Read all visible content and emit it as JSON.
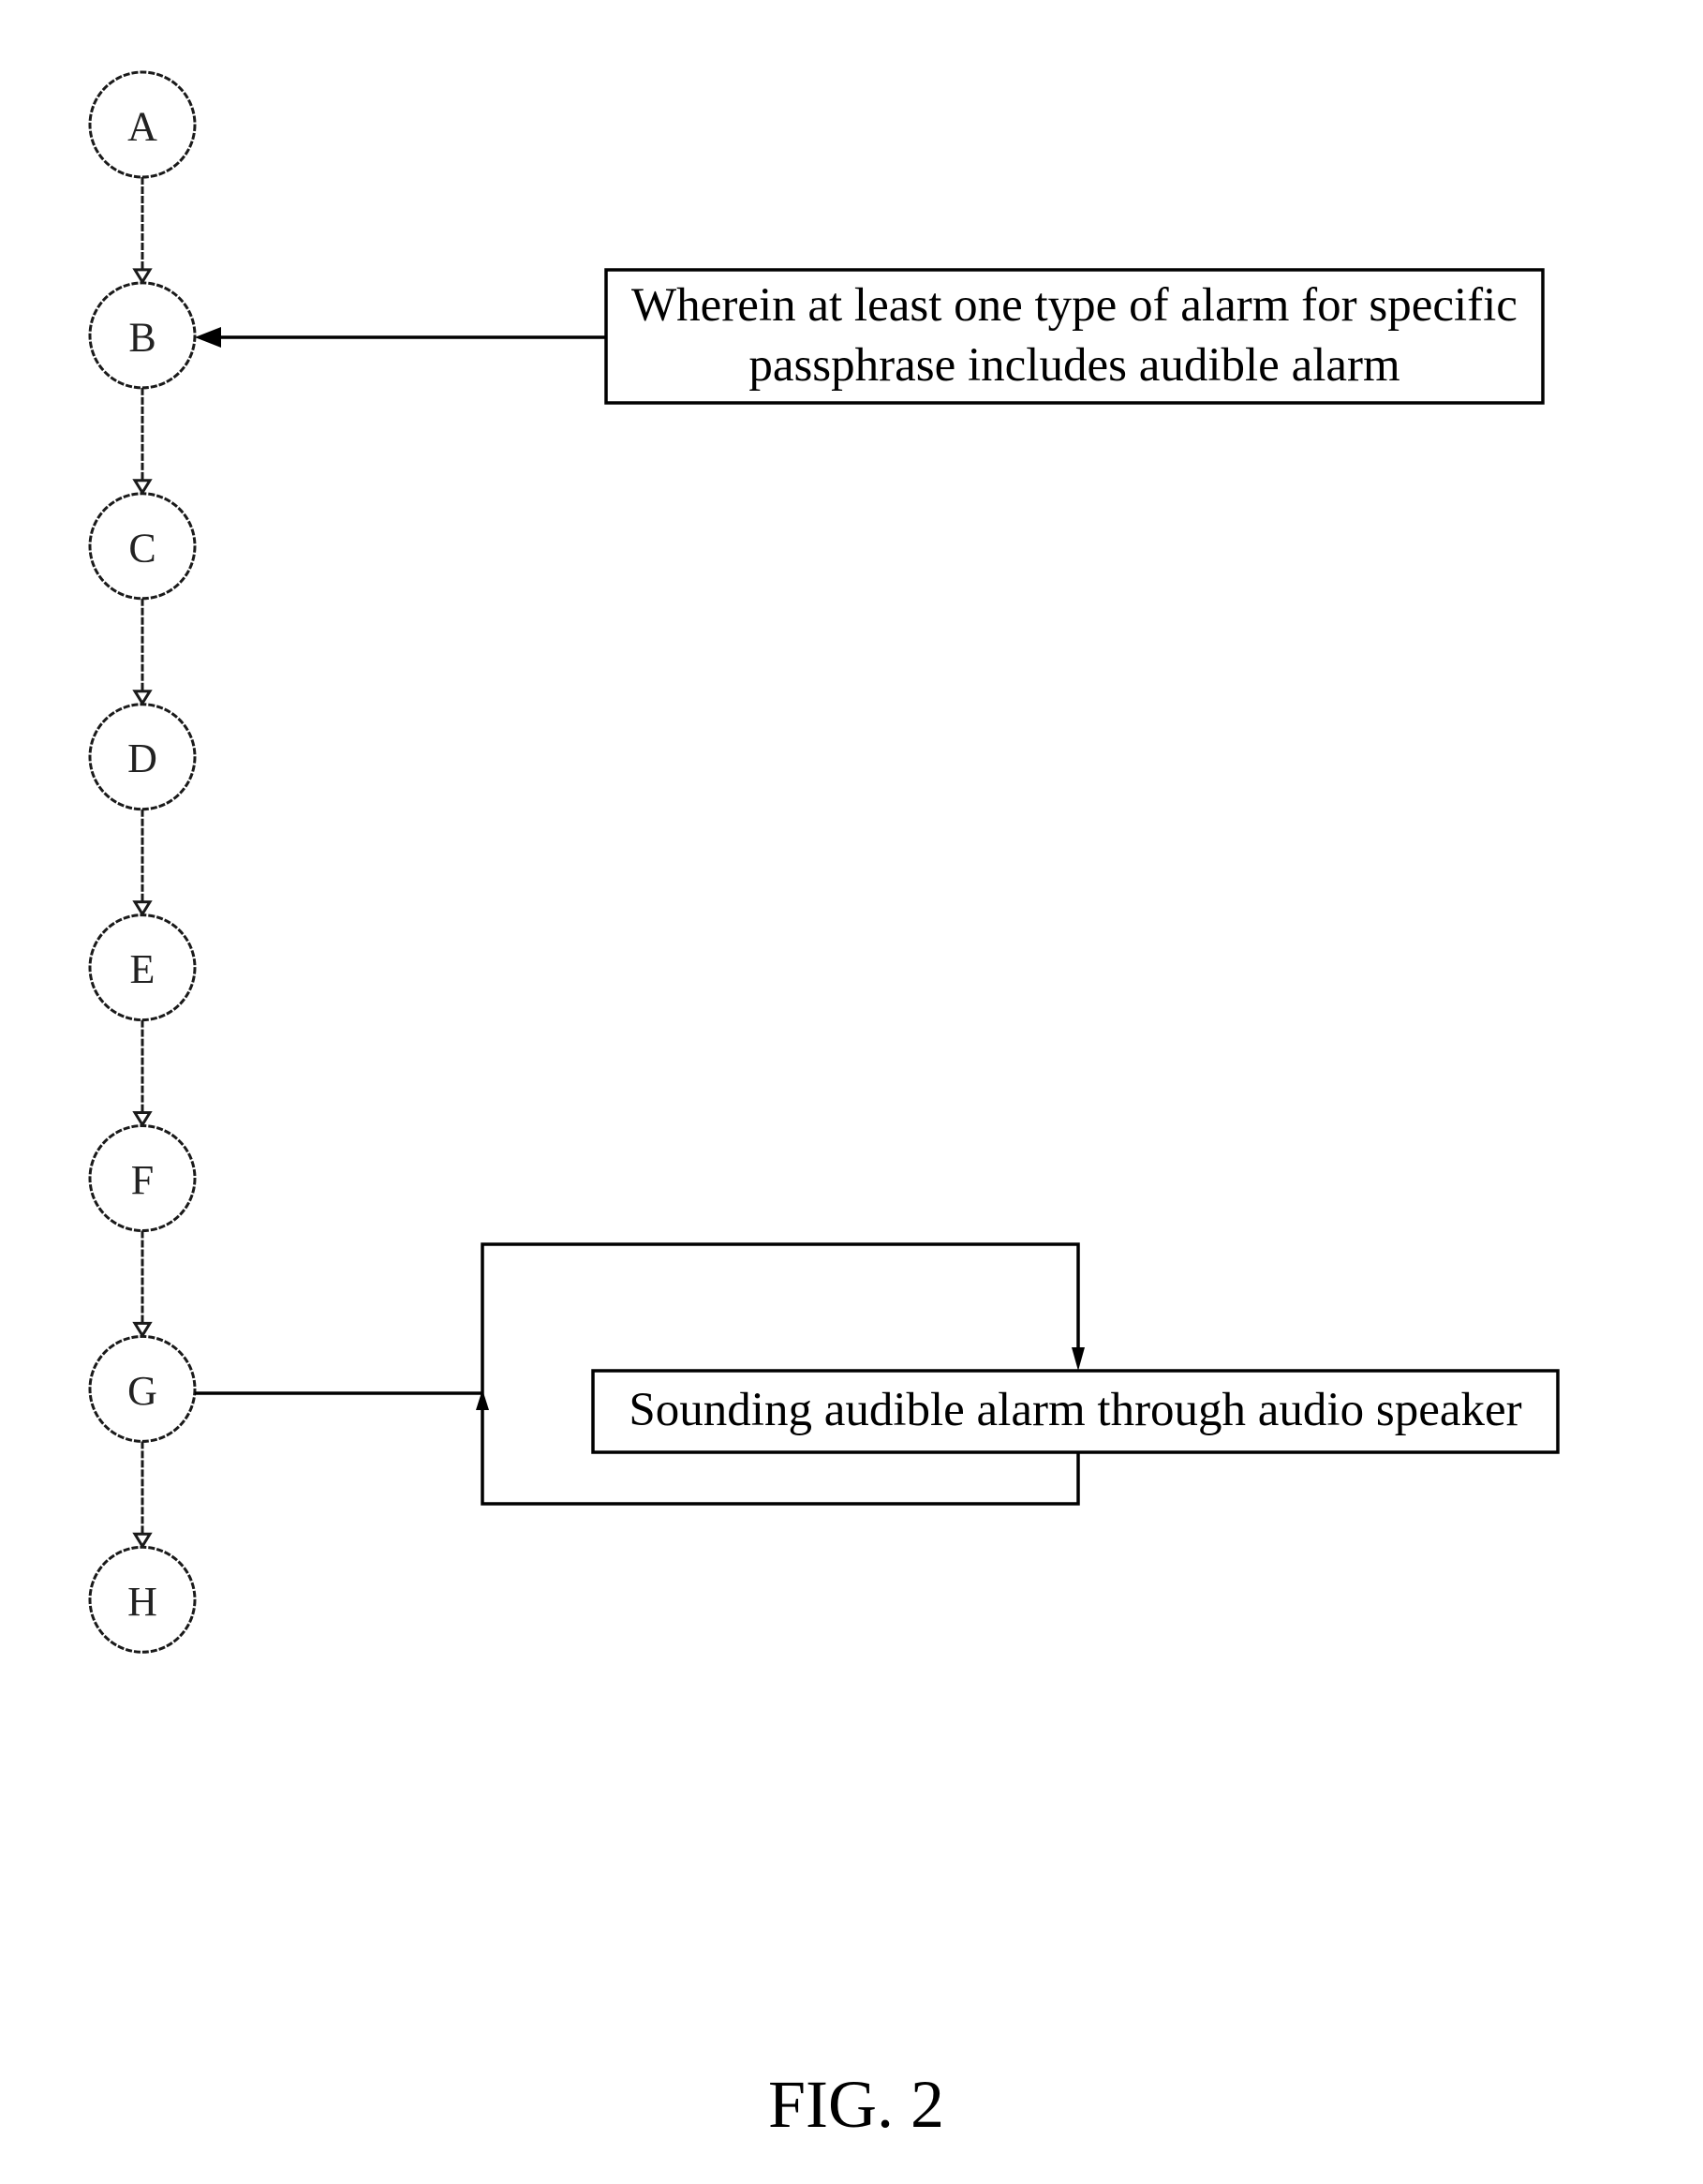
{
  "figure": {
    "label": "FIG. 2"
  },
  "nodes": [
    {
      "id": "A",
      "label": "A"
    },
    {
      "id": "B",
      "label": "B"
    },
    {
      "id": "C",
      "label": "C"
    },
    {
      "id": "D",
      "label": "D"
    },
    {
      "id": "E",
      "label": "E"
    },
    {
      "id": "F",
      "label": "F"
    },
    {
      "id": "G",
      "label": "G"
    },
    {
      "id": "H",
      "label": "H"
    }
  ],
  "edges": [
    {
      "from": "A",
      "to": "B"
    },
    {
      "from": "B",
      "to": "C"
    },
    {
      "from": "C",
      "to": "D"
    },
    {
      "from": "D",
      "to": "E"
    },
    {
      "from": "E",
      "to": "F"
    },
    {
      "from": "F",
      "to": "G"
    },
    {
      "from": "G",
      "to": "H"
    }
  ],
  "annotations": {
    "b_box": {
      "attached_to": "B",
      "lines": [
        "Wherein at least one type of alarm for specific",
        "passphrase includes audible alarm"
      ]
    },
    "g_box": {
      "attached_to": "G",
      "lines": [
        "Sounding audible alarm through audio speaker"
      ],
      "loop": "repeat"
    }
  }
}
